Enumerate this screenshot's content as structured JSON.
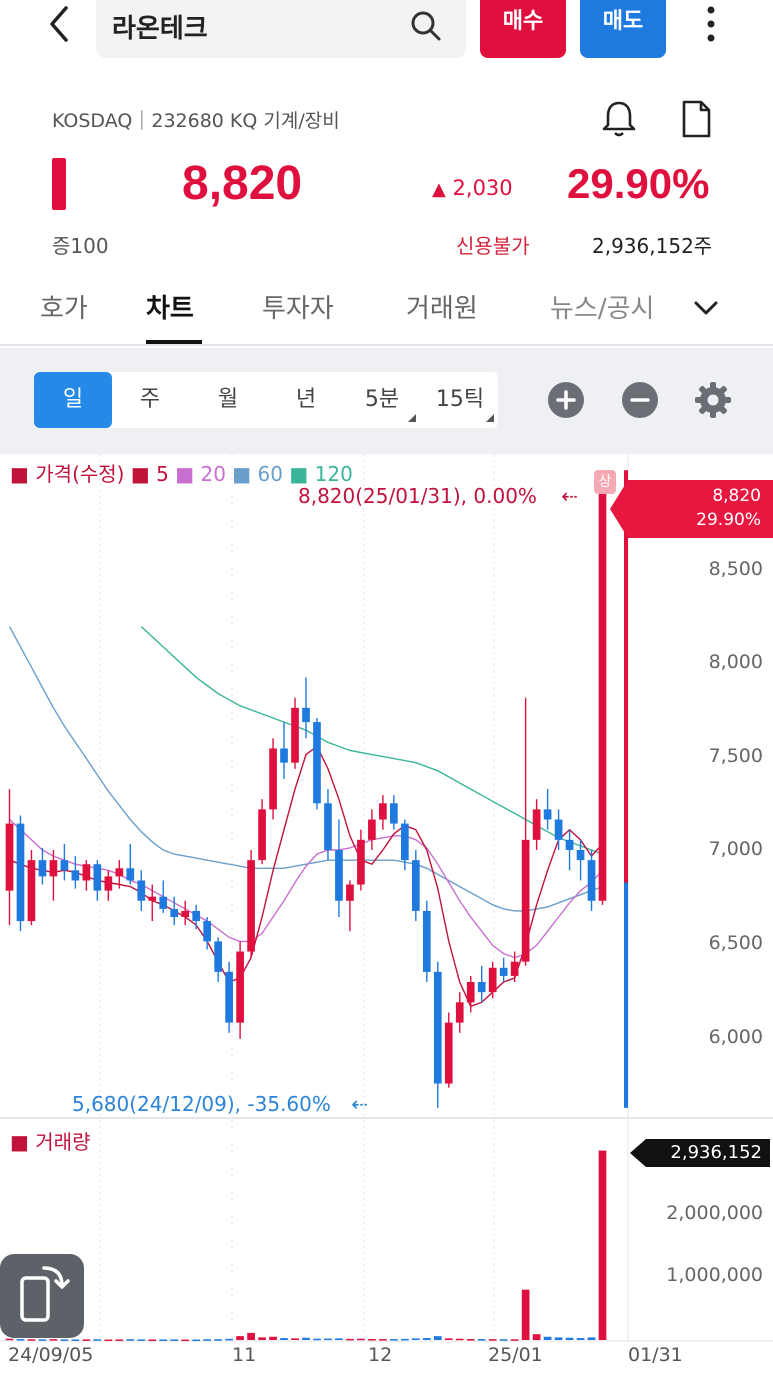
{
  "header": {
    "stock_name": "라온테크",
    "buy_label": "매수",
    "sell_label": "매도"
  },
  "info": {
    "market_line": "KOSDAQ｜232680 KQ 기계/장비",
    "price": "8,820",
    "change": "2,030",
    "change_rate": "29.90%",
    "margin": "증100",
    "credit": "신용불가",
    "volume": "2,936,152주"
  },
  "tabs": [
    "호가",
    "차트",
    "투자자",
    "거래원",
    "뉴스/공시"
  ],
  "periods": [
    "일",
    "주",
    "월",
    "년",
    "5분",
    "15틱"
  ],
  "colors": {
    "up": "#e0103e",
    "down": "#1f7ae0",
    "ma5": "#c0123a",
    "ma20": "#c86fd0",
    "ma60": "#6a9ecb",
    "ma120": "#3bb59a"
  },
  "chart_data": {
    "type": "candlestick",
    "legend": {
      "price_label": "가격(수정)",
      "ma5": "5",
      "ma20": "20",
      "ma60": "60",
      "ma120": "120",
      "volume_label": "거래량",
      "limit_badge": "상"
    },
    "annotations": {
      "high": "8,820(25/01/31), 0.00%",
      "low": "5,680(24/12/09), -35.60%"
    },
    "last_price_tag": {
      "price": "8,820",
      "rate": "29.90%"
    },
    "last_volume_tag": "2,936,152",
    "y_ticks": [
      "8,500",
      "8,000",
      "7,500",
      "7,000",
      "6,500",
      "6,000"
    ],
    "y_range": [
      5650,
      8900
    ],
    "volume_ticks": [
      "2,000,000",
      "1,000,000"
    ],
    "x_ticks": [
      "24/09/05",
      "11",
      "12",
      "25/01",
      "01/31"
    ],
    "candles": [
      [
        6750,
        7250,
        6580,
        7080
      ],
      [
        7080,
        7120,
        6550,
        6600
      ],
      [
        6600,
        6950,
        6580,
        6900
      ],
      [
        6900,
        6960,
        6780,
        6820
      ],
      [
        6820,
        6950,
        6700,
        6900
      ],
      [
        6900,
        6980,
        6800,
        6850
      ],
      [
        6850,
        6920,
        6760,
        6800
      ],
      [
        6800,
        6900,
        6750,
        6880
      ],
      [
        6880,
        6900,
        6700,
        6750
      ],
      [
        6750,
        6850,
        6700,
        6820
      ],
      [
        6820,
        6900,
        6760,
        6860
      ],
      [
        6860,
        6980,
        6780,
        6800
      ],
      [
        6800,
        6850,
        6650,
        6700
      ],
      [
        6700,
        6780,
        6600,
        6720
      ],
      [
        6720,
        6800,
        6640,
        6660
      ],
      [
        6660,
        6720,
        6580,
        6620
      ],
      [
        6620,
        6700,
        6580,
        6650
      ],
      [
        6650,
        6680,
        6560,
        6600
      ],
      [
        6600,
        6620,
        6460,
        6500
      ],
      [
        6500,
        6520,
        6300,
        6350
      ],
      [
        6350,
        6400,
        6050,
        6100
      ],
      [
        6100,
        6500,
        6020,
        6450
      ],
      [
        6450,
        6950,
        6420,
        6900
      ],
      [
        6900,
        7200,
        6880,
        7150
      ],
      [
        7150,
        7500,
        7100,
        7450
      ],
      [
        7450,
        7580,
        7300,
        7380
      ],
      [
        7380,
        7700,
        7350,
        7650
      ],
      [
        7650,
        7800,
        7500,
        7580
      ],
      [
        7580,
        7600,
        7150,
        7180
      ],
      [
        7180,
        7250,
        6900,
        6950
      ],
      [
        6950,
        7100,
        6620,
        6700
      ],
      [
        6700,
        6800,
        6550,
        6780
      ],
      [
        6780,
        7050,
        6750,
        7000
      ],
      [
        7000,
        7150,
        6950,
        7100
      ],
      [
        7100,
        7220,
        7050,
        7180
      ],
      [
        7180,
        7220,
        7050,
        7080
      ],
      [
        7080,
        7100,
        6850,
        6900
      ],
      [
        6900,
        6950,
        6600,
        6650
      ],
      [
        6650,
        6700,
        6300,
        6350
      ],
      [
        6350,
        6400,
        5680,
        5800
      ],
      [
        5800,
        6150,
        5780,
        6100
      ],
      [
        6100,
        6250,
        6050,
        6200
      ],
      [
        6200,
        6330,
        6150,
        6300
      ],
      [
        6300,
        6380,
        6200,
        6250
      ],
      [
        6250,
        6400,
        6220,
        6370
      ],
      [
        6370,
        6420,
        6300,
        6330
      ],
      [
        6330,
        6450,
        6300,
        6400
      ],
      [
        6400,
        7700,
        6380,
        7000
      ],
      [
        7000,
        7200,
        6950,
        7150
      ],
      [
        7150,
        7250,
        7050,
        7100
      ],
      [
        7100,
        7150,
        6950,
        7000
      ],
      [
        7000,
        7050,
        6850,
        6950
      ],
      [
        6950,
        7000,
        6800,
        6900
      ],
      [
        6900,
        6950,
        6650,
        6700
      ],
      [
        6700,
        8820,
        6680,
        8820
      ]
    ],
    "ma5": [
      6900,
      6880,
      6860,
      6850,
      6840,
      6850,
      6840,
      6820,
      6800,
      6790,
      6780,
      6770,
      6740,
      6700,
      6680,
      6650,
      6620,
      6580,
      6500,
      6400,
      6300,
      6320,
      6420,
      6620,
      6850,
      7050,
      7250,
      7420,
      7460,
      7350,
      7200,
      7020,
      6900,
      6880,
      6950,
      7030,
      7070,
      7050,
      6950,
      6760,
      6500,
      6300,
      6180,
      6200,
      6250,
      6300,
      6320,
      6480,
      6680,
      6850,
      7000,
      7050,
      7000,
      6920,
      6980
    ],
    "ma20": [
      7100,
      7050,
      7000,
      6950,
      6920,
      6900,
      6880,
      6870,
      6860,
      6850,
      6830,
      6800,
      6780,
      6750,
      6720,
      6690,
      6660,
      6630,
      6600,
      6560,
      6520,
      6500,
      6500,
      6540,
      6620,
      6700,
      6790,
      6870,
      6930,
      6950,
      6950,
      6960,
      6980,
      7000,
      7010,
      7020,
      7020,
      7000,
      6960,
      6880,
      6790,
      6700,
      6620,
      6550,
      6480,
      6440,
      6420,
      6440,
      6480,
      6550,
      6620,
      6690,
      6750,
      6790,
      6850
    ],
    "ma60": [
      8050,
      7950,
      7850,
      7750,
      7650,
      7560,
      7480,
      7400,
      7320,
      7240,
      7170,
      7100,
      7040,
      6990,
      6950,
      6930,
      6920,
      6910,
      6900,
      6890,
      6880,
      6870,
      6860,
      6860,
      6860,
      6860,
      6870,
      6880,
      6890,
      6900,
      6900,
      6900,
      6900,
      6900,
      6900,
      6900,
      6890,
      6880,
      6860,
      6830,
      6800,
      6770,
      6740,
      6710,
      6680,
      6660,
      6650,
      6650,
      6660,
      6670,
      6690,
      6710,
      6730,
      6750,
      6770
    ],
    "ma120": [
      null,
      null,
      null,
      null,
      null,
      null,
      null,
      null,
      null,
      null,
      null,
      null,
      8050,
      8000,
      7950,
      7900,
      7850,
      7800,
      7760,
      7720,
      7690,
      7660,
      7640,
      7620,
      7600,
      7580,
      7560,
      7540,
      7510,
      7480,
      7460,
      7440,
      7430,
      7420,
      7410,
      7400,
      7390,
      7380,
      7360,
      7340,
      7310,
      7280,
      7250,
      7220,
      7190,
      7160,
      7130,
      7100,
      7070,
      7040,
      7010,
      6990,
      6970,
      6950,
      6930
    ],
    "volumes": [
      20000,
      15000,
      12000,
      10000,
      14000,
      9000,
      8000,
      9000,
      11000,
      7000,
      8000,
      12000,
      9000,
      7000,
      8000,
      9000,
      6000,
      7000,
      10000,
      12000,
      18000,
      60000,
      110000,
      40000,
      50000,
      30000,
      25000,
      35000,
      20000,
      22000,
      25000,
      18000,
      20000,
      16000,
      15000,
      14000,
      17000,
      25000,
      30000,
      60000,
      25000,
      20000,
      15000,
      14000,
      13000,
      12000,
      11000,
      780000,
      90000,
      50000,
      40000,
      35000,
      30000,
      40000,
      2936152
    ],
    "volume_range": [
      0,
      3100000
    ]
  }
}
